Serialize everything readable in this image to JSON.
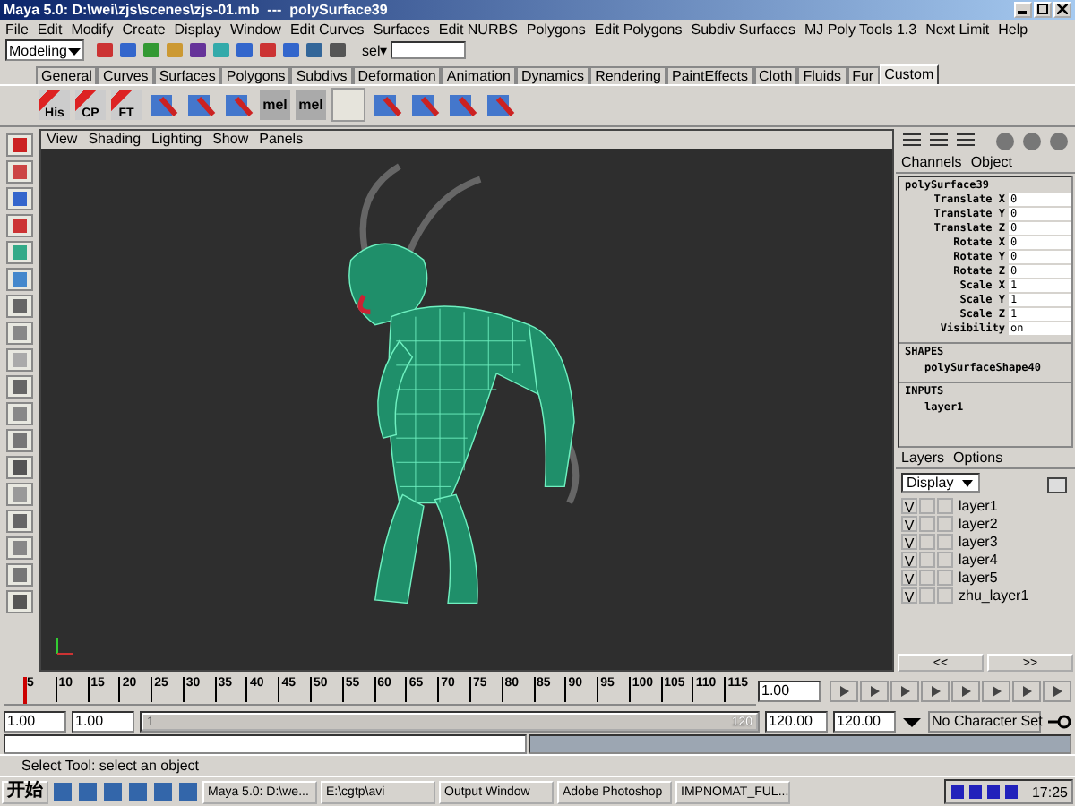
{
  "window": {
    "title": "Maya 5.0: D:\\wei\\zjs\\scenes\\zjs-01.mb  ---  polySurface39"
  },
  "menu": [
    "File",
    "Edit",
    "Modify",
    "Create",
    "Display",
    "Window",
    "Edit Curves",
    "Surfaces",
    "Edit NURBS",
    "Polygons",
    "Edit Polygons",
    "Subdiv Surfaces",
    "MJ Poly Tools 1.3",
    "Next Limit",
    "Help"
  ],
  "toolbar": {
    "mode": "Modeling",
    "sel_label": "sel▾"
  },
  "shelf_tabs": [
    {
      "label": "General",
      "selected": false
    },
    {
      "label": "Curves",
      "selected": false
    },
    {
      "label": "Surfaces",
      "selected": false
    },
    {
      "label": "Polygons",
      "selected": false
    },
    {
      "label": "Subdivs",
      "selected": false
    },
    {
      "label": "Deformation",
      "selected": false
    },
    {
      "label": "Animation",
      "selected": false
    },
    {
      "label": "Dynamics",
      "selected": false
    },
    {
      "label": "Rendering",
      "selected": false
    },
    {
      "label": "PaintEffects",
      "selected": false
    },
    {
      "label": "Cloth",
      "selected": false
    },
    {
      "label": "Fluids",
      "selected": false
    },
    {
      "label": "Fur",
      "selected": false
    },
    {
      "label": "Custom",
      "selected": true
    }
  ],
  "shelf": [
    {
      "kind": "labeled",
      "label": "His"
    },
    {
      "kind": "labeled",
      "label": "CP"
    },
    {
      "kind": "labeled",
      "label": "FT"
    },
    {
      "kind": "icon"
    },
    {
      "kind": "icon"
    },
    {
      "kind": "icon"
    },
    {
      "kind": "mel",
      "label": "mel"
    },
    {
      "kind": "mel",
      "label": "mel"
    },
    {
      "kind": "blank"
    },
    {
      "kind": "icon"
    },
    {
      "kind": "icon"
    },
    {
      "kind": "icon"
    },
    {
      "kind": "icon"
    }
  ],
  "viewport": {
    "menu": [
      "View",
      "Shading",
      "Lighting",
      "Show",
      "Panels"
    ]
  },
  "channel_box": {
    "menu": [
      "Channels",
      "Object"
    ],
    "object": "polySurface39",
    "attributes": [
      {
        "name": "Translate X",
        "value": "0"
      },
      {
        "name": "Translate Y",
        "value": "0"
      },
      {
        "name": "Translate Z",
        "value": "0"
      },
      {
        "name": "Rotate X",
        "value": "0"
      },
      {
        "name": "Rotate Y",
        "value": "0"
      },
      {
        "name": "Rotate Z",
        "value": "0"
      },
      {
        "name": "Scale X",
        "value": "1"
      },
      {
        "name": "Scale Y",
        "value": "1"
      },
      {
        "name": "Scale Z",
        "value": "1"
      },
      {
        "name": "Visibility",
        "value": "on"
      }
    ],
    "shapes_heading": "SHAPES",
    "shape": "polySurfaceShape40",
    "inputs_heading": "INPUTS",
    "input": "layer1"
  },
  "layers": {
    "menu": [
      "Layers",
      "Options"
    ],
    "display": "Display",
    "items": [
      {
        "label": "V",
        "name": "layer1"
      },
      {
        "label": "V",
        "name": "layer2"
      },
      {
        "label": "V",
        "name": "layer3"
      },
      {
        "label": "V",
        "name": "layer4"
      },
      {
        "label": "V",
        "name": "layer5"
      },
      {
        "label": "V",
        "name": "zhu_layer1"
      }
    ],
    "nav_buttons": [
      "<<",
      ">>"
    ]
  },
  "timeline": {
    "ticks": [
      "5",
      "10",
      "15",
      "20",
      "25",
      "30",
      "35",
      "40",
      "45",
      "50",
      "55",
      "60",
      "65",
      "70",
      "75",
      "80",
      "85",
      "90",
      "95",
      "100",
      "105",
      "110",
      "115"
    ],
    "current_frame": "1.00",
    "level": 0
  },
  "range": {
    "start": "1.00",
    "playback_start": "1.00",
    "slider_start": "1",
    "slider_end": "120",
    "level": 1,
    "playback_end": "120.00",
    "end": "120.00",
    "character_set": "No Character Set"
  },
  "help_line": "Select Tool: select an object",
  "taskbar": {
    "start": "开始",
    "tasks": [
      "Maya 5.0: D:\\we...",
      "E:\\cgtp\\avi",
      "Output Window",
      "Adobe Photoshop",
      "IMPNOMAT_FUL..."
    ],
    "clock": "17:25"
  }
}
